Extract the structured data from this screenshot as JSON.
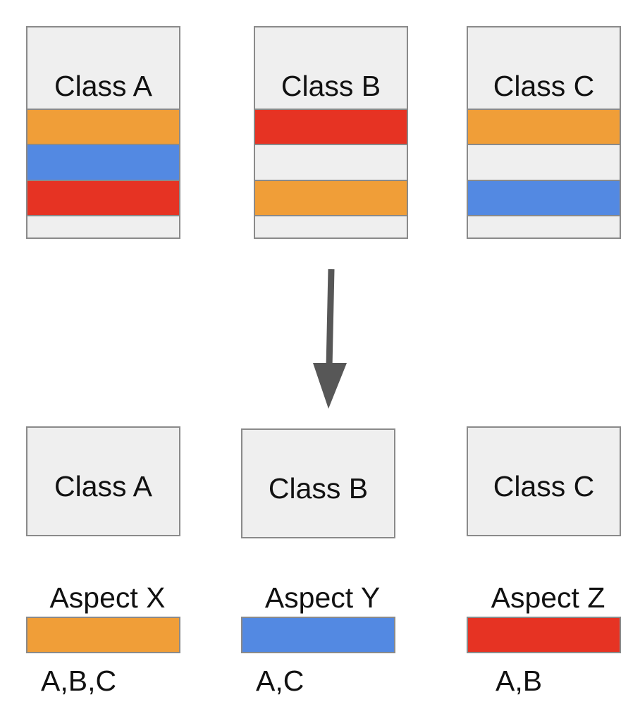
{
  "colors": {
    "orange": "#F09E38",
    "blue": "#5389E2",
    "red": "#E63323",
    "box": "#EFEFEF",
    "border": "#8A8A8A",
    "arrow": "#575757"
  },
  "top_classes": [
    {
      "label": "Class A",
      "stripes": [
        "orange",
        "blue",
        "red",
        "empty"
      ]
    },
    {
      "label": "Class B",
      "stripes": [
        "red",
        "empty",
        "orange",
        "empty"
      ]
    },
    {
      "label": "Class C",
      "stripes": [
        "orange",
        "empty",
        "blue",
        "empty"
      ]
    }
  ],
  "bottom_classes": [
    {
      "label": "Class A"
    },
    {
      "label": "Class B"
    },
    {
      "label": "Class C"
    }
  ],
  "aspects": [
    {
      "label": "Aspect X",
      "color": "orange",
      "members": "A,B,C"
    },
    {
      "label": "Aspect Y",
      "color": "blue",
      "members": "A,C"
    },
    {
      "label": "Aspect Z",
      "color": "red",
      "members": "A,B"
    }
  ]
}
